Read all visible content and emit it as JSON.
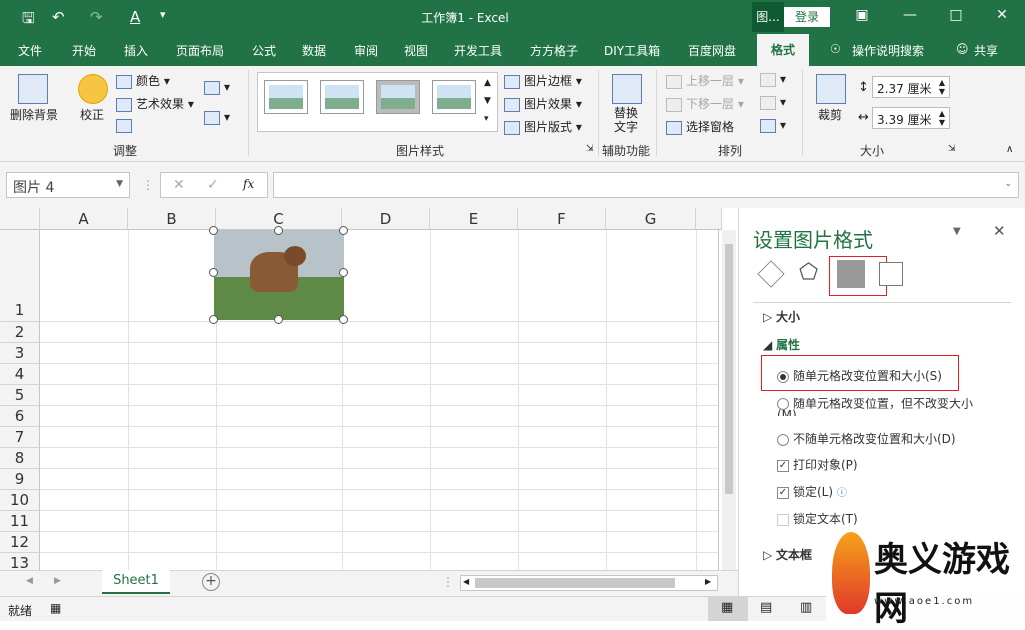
{
  "titlebar": {
    "title": "工作簿1 - Excel",
    "context_tab": "图...",
    "login": "登录",
    "icons": [
      "save-icon",
      "undo-icon",
      "redo-icon",
      "font-color-icon",
      "customize-icon",
      "ribbon-display-icon",
      "minimize-icon",
      "maximize-icon",
      "close-icon"
    ]
  },
  "menu": {
    "tabs": [
      "文件",
      "开始",
      "插入",
      "页面布局",
      "公式",
      "数据",
      "审阅",
      "视图",
      "开发工具",
      "方方格子",
      "DIY工具箱",
      "百度网盘",
      "格式"
    ],
    "active_tab": "格式",
    "tell_me": "操作说明搜索",
    "share": "共享"
  },
  "ribbon": {
    "adjust": {
      "remove_bg": "删除背景",
      "correct": "校正",
      "color": "颜色",
      "artistic": "艺术效果",
      "label": "调整"
    },
    "styles": {
      "border": "图片边框",
      "effects": "图片效果",
      "layout": "图片版式",
      "label": "图片样式"
    },
    "accessibility": {
      "alt_text": "替换\n文字",
      "label": "辅助功能"
    },
    "arrange": {
      "forward": "上移一层",
      "backward": "下移一层",
      "selection_pane": "选择窗格",
      "label": "排列"
    },
    "size": {
      "crop": "裁剪",
      "height": "2.37 厘米",
      "width": "3.39 厘米",
      "label": "大小"
    }
  },
  "formula_bar": {
    "name_box": "图片 4",
    "fx": "fx",
    "formula": ""
  },
  "grid": {
    "columns": [
      "A",
      "B",
      "C",
      "D",
      "E",
      "F",
      "G"
    ],
    "rows": [
      "1",
      "2",
      "3",
      "4",
      "5",
      "6",
      "7",
      "8",
      "9",
      "10",
      "11",
      "12",
      "13"
    ]
  },
  "sheets": {
    "active": "Sheet1"
  },
  "status": {
    "ready": "就绪"
  },
  "pane": {
    "title": "设置图片格式",
    "size_section": "大小",
    "props_section": "属性",
    "option_move_size": "随单元格改变位置和大小(S)",
    "option_move_only": "随单元格改变位置，但不改变大小(M)",
    "option_none": "不随单元格改变位置和大小(D)",
    "print_object": "打印对象(P)",
    "locked": "锁定(L)",
    "lock_text": "锁定文本(T)",
    "text_box_section": "文本框",
    "selected_option": "option_move_size"
  },
  "watermark": {
    "name": "奥义游戏网",
    "url": "www.aoe1.com"
  }
}
